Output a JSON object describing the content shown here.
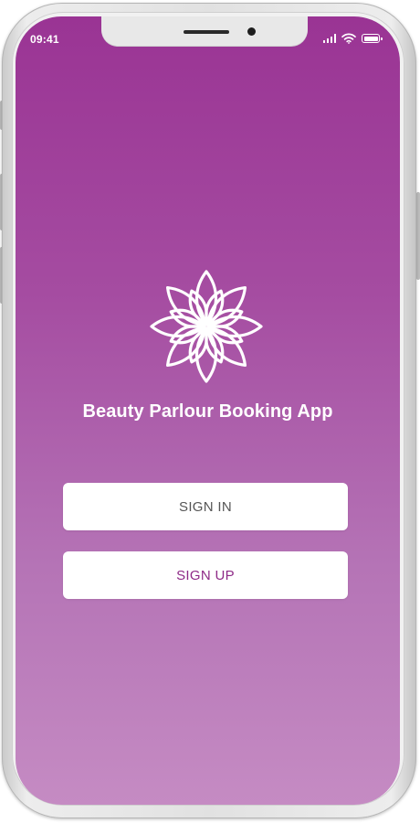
{
  "status_bar": {
    "time": "09:41",
    "icons": [
      "signal-bars-icon",
      "wifi-icon",
      "battery-icon"
    ]
  },
  "app": {
    "logo_icon": "lotus-flower-icon",
    "title": "Beauty Parlour Booking App"
  },
  "actions": {
    "sign_in_label": "SIGN IN",
    "sign_up_label": "SIGN UP"
  },
  "colors": {
    "gradient_top": "#9a3494",
    "gradient_bottom": "#c58bc3",
    "sign_up_text": "#8e2a87",
    "sign_in_text": "#555555",
    "button_bg": "#ffffff"
  }
}
